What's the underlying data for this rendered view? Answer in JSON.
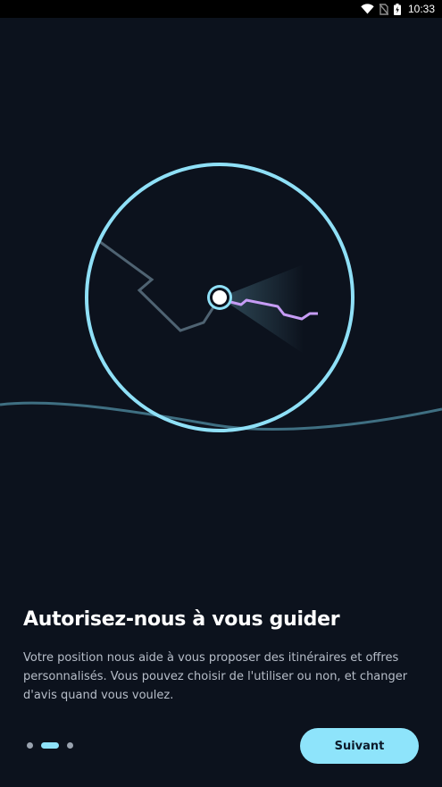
{
  "status_bar": {
    "time": "10:33",
    "icons": [
      "wifi-icon",
      "no-sim-icon",
      "battery-charging-icon"
    ]
  },
  "illustration": {
    "description_icons": [
      "location-puck-icon",
      "route-path",
      "heading-cone"
    ],
    "colors": {
      "circle": "#8fe0f7",
      "route_past": "#4f6372",
      "route_ahead": "#c69cf5",
      "horizon": "#3f6f82"
    }
  },
  "onboarding": {
    "title": "Autorisez-nous à vous guider",
    "description": "Votre position nous aide à vous proposer des itinéraires et offres personnalisés. Vous pouvez choisir de l'utiliser ou non, et changer d'avis quand vous voulez."
  },
  "pager": {
    "pages": 3,
    "current": 2
  },
  "actions": {
    "next_label": "Suivant"
  },
  "colors": {
    "background": "#0c121d",
    "accent": "#8ee4fb",
    "text_secondary": "#b7bec9"
  }
}
